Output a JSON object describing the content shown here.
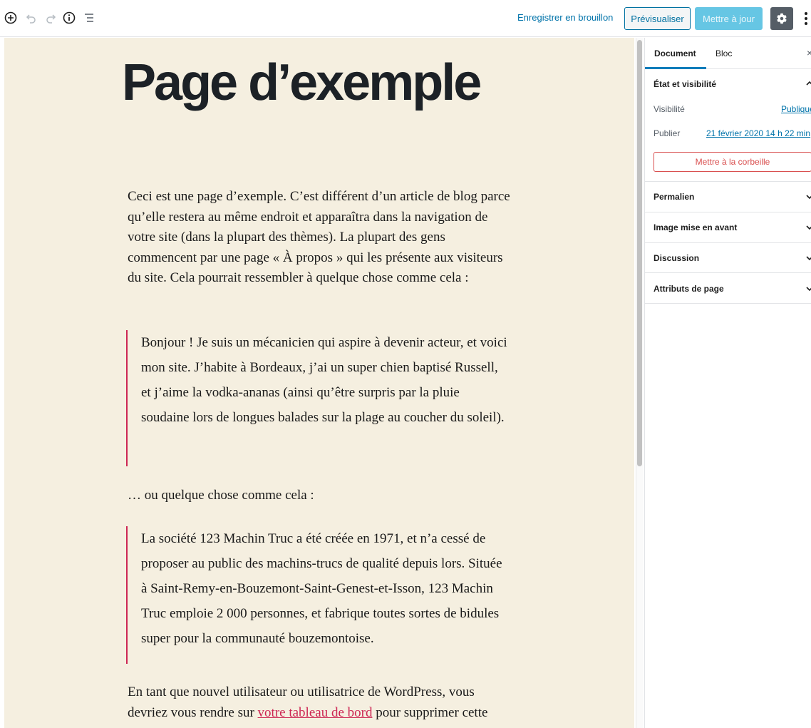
{
  "toolbar": {
    "icons": [
      "add-block-icon",
      "undo-icon",
      "redo-icon",
      "info-icon",
      "outline-icon"
    ],
    "save_draft_label": "Enregistrer en brouillon",
    "preview_label": "Prévisualiser",
    "update_label": "Mettre à jour",
    "settings_icon": "gear-icon",
    "more_icon": "vertical-ellipsis-icon"
  },
  "editor": {
    "title": "Page d’exemple",
    "paragraph1": "Ceci est une page d’exemple. C’est différent d’un article de blog parce qu’elle restera au même endroit et apparaîtra dans la navigation de votre site (dans la plupart des thèmes). La plupart des gens commencent par une page « À propos » qui les présente aux visiteurs du site. Cela pourrait ressembler à quelque chose comme cela :",
    "quote1": "Bonjour ! Je suis un mécanicien qui aspire à devenir acteur, et voici mon site. J’habite à Bordeaux, j’ai un super chien baptisé Russell, et j’aime la vodka-ananas (ainsi qu’être surpris par la pluie soudaine lors de longues balades sur la plage au coucher du soleil).",
    "paragraph2": "… ou quelque chose comme cela :",
    "quote2": "La société 123 Machin Truc a été créée en 1971, et n’a cessé de proposer au public des machins-trucs de qualité depuis lors. Située à Saint-Remy-en-Bouzemont-Saint-Genest-et-Isson, 123 Machin Truc emploie 2 000 personnes, et fabrique toutes sortes de bidules super pour la communauté bouzemontoise.",
    "paragraph3_before": "En tant que nouvel utilisateur ou utilisatrice de WordPress, vous devriez vous rendre sur ",
    "paragraph3_link": "votre tableau de bord",
    "paragraph3_after": " pour supprimer cette"
  },
  "sidebar": {
    "tabs": [
      "Document",
      "Bloc"
    ],
    "close_icon": "close-icon",
    "status_panel": {
      "title": "État et visibilité",
      "visibility_label": "Visibilité",
      "visibility_value": "Publique",
      "publish_label": "Publier",
      "publish_value": "21 février 2020 14 h 22 min",
      "trash_label": "Mettre à la corbeille"
    },
    "panels": [
      "Permalien",
      "Image mise en avant",
      "Discussion",
      "Attributs de page"
    ]
  }
}
